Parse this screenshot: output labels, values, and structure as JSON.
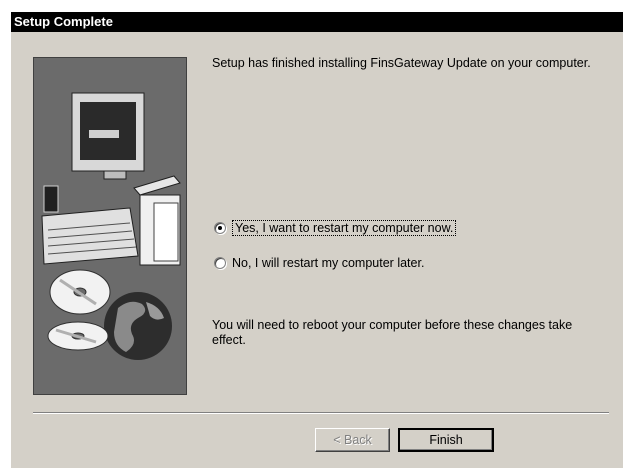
{
  "window": {
    "title": "Setup Complete"
  },
  "message": {
    "top": "Setup has finished installing FinsGateway Update on your computer.",
    "bottom": "You will need to reboot your computer before these changes take effect."
  },
  "options": {
    "restart_now": "Yes, I want to restart my computer now.",
    "restart_later": "No, I will restart my computer later.",
    "selected": "restart_now"
  },
  "buttons": {
    "back": "< Back",
    "finish": "Finish"
  },
  "illustration": {
    "icons": [
      "computer-monitor-icon",
      "keyboard-icon",
      "cd-disc-icon",
      "globe-icon"
    ]
  }
}
